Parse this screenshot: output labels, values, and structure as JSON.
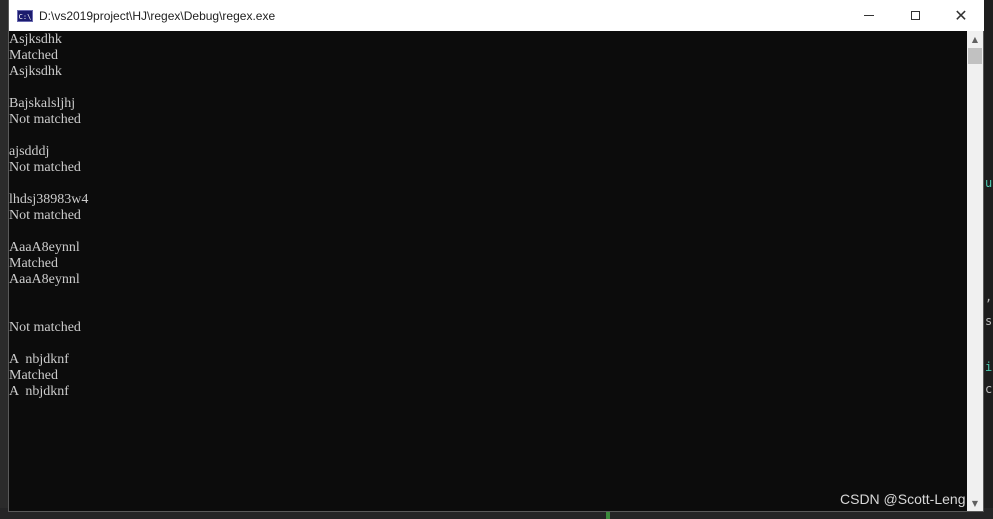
{
  "window": {
    "title": "D:\\vs2019project\\HJ\\regex\\Debug\\regex.exe",
    "app_icon_text": "C:\\"
  },
  "console_lines": [
    "Asjksdhk",
    "Matched",
    "Asjksdhk",
    "",
    "Bajskalsljhj",
    "Not matched",
    "",
    "ajsdddj",
    "Not matched",
    "",
    "lhdsj38983w4",
    "Not matched",
    "",
    "AaaA8eynnl",
    "Matched",
    "AaaA8eynnl",
    "",
    "",
    "Not matched",
    "",
    "A  nbjdknf",
    "Matched",
    "A  nbjdknf"
  ],
  "watermark": "CSDN @Scott-Leng",
  "colors": {
    "console_bg": "#0c0c0c",
    "console_text": "#cccccc",
    "titlebar_bg": "#ffffff"
  }
}
